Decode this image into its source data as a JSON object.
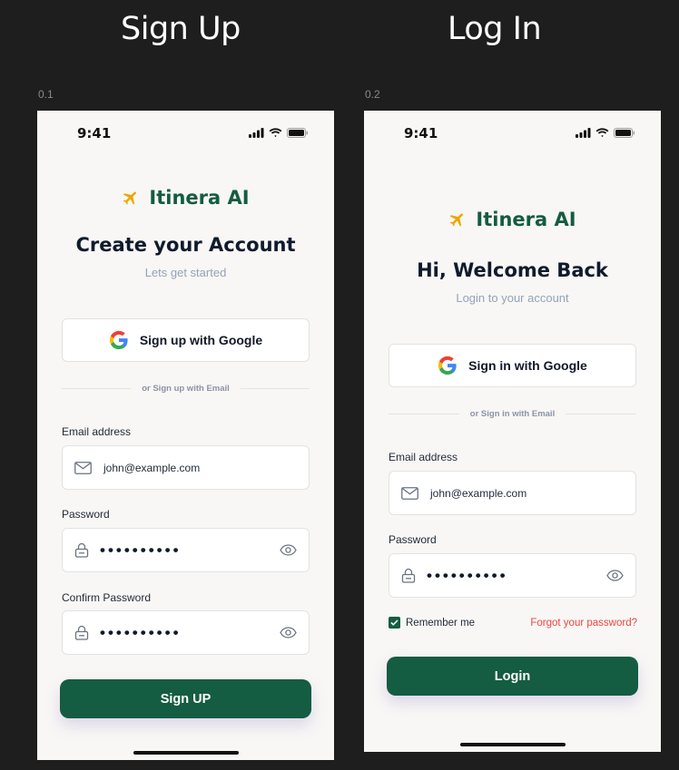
{
  "colors": {
    "brand": "#145c42",
    "accent": "#f0a500",
    "forgot": "#ef4444",
    "background": "#1e1e1e"
  },
  "headings": {
    "signup": "Sign Up",
    "login": "Log In"
  },
  "frames": {
    "signup_label": "0.1",
    "login_label": "0.2"
  },
  "status_bar": {
    "time": "9:41",
    "icons": [
      "signal-icon",
      "wifi-icon",
      "battery-icon"
    ]
  },
  "brand": {
    "name": "Itinera AI",
    "icon": "airplane-icon"
  },
  "signup": {
    "title": "Create your Account",
    "subtitle": "Lets get started",
    "google_button": "Sign up with Google",
    "divider": "or Sign up with Email",
    "email_label": "Email address",
    "email_value": "john@example.com",
    "password_label": "Password",
    "password_value": "••••••••••",
    "confirm_label": "Confirm Password",
    "confirm_value": "••••••••••",
    "submit": "Sign UP"
  },
  "login": {
    "title": "Hi, Welcome Back",
    "subtitle": "Login to your account",
    "google_button": "Sign in with Google",
    "divider": "or Sign in with Email",
    "email_label": "Email address",
    "email_value": "john@example.com",
    "password_label": "Password",
    "password_value": "••••••••••",
    "remember": "Remember me",
    "remember_checked": true,
    "forgot": "Forgot your password?",
    "submit": "Login"
  }
}
